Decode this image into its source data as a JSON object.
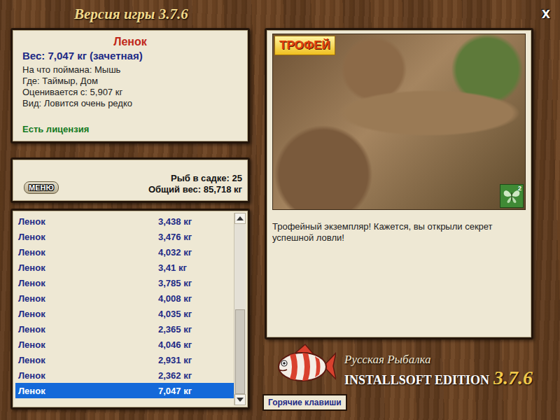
{
  "window": {
    "title": "Версия игры 3.7.6",
    "close": "X"
  },
  "fish_info": {
    "name": "Ленок",
    "weight": "Вес: 7,047 кг (зачетная)",
    "details": [
      "На что поймана: Мышь",
      "Где: Таймыр, Дом",
      "Оценивается с: 5,907 кг",
      "Вид: Ловится очень редко"
    ],
    "license": "Есть лицензия"
  },
  "keepnet": {
    "menu_button": "МЕНЮ",
    "count": "Рыб в садке: 25",
    "total": "Общий вес: 85,718 кг"
  },
  "catch_list": {
    "scroll": {
      "level": 1
    },
    "rows": [
      {
        "name": "Ленок",
        "weight": "3,438 кг",
        "selected": false
      },
      {
        "name": "Ленок",
        "weight": "3,476 кг",
        "selected": false
      },
      {
        "name": "Ленок",
        "weight": "4,032 кг",
        "selected": false
      },
      {
        "name": "Ленок",
        "weight": "3,41 кг",
        "selected": false
      },
      {
        "name": "Ленок",
        "weight": "3,785 кг",
        "selected": false
      },
      {
        "name": "Ленок",
        "weight": "4,008 кг",
        "selected": false
      },
      {
        "name": "Ленок",
        "weight": "4,035 кг",
        "selected": false
      },
      {
        "name": "Ленок",
        "weight": "2,365 кг",
        "selected": false
      },
      {
        "name": "Ленок",
        "weight": "4,046 кг",
        "selected": false
      },
      {
        "name": "Ленок",
        "weight": "2,931 кг",
        "selected": false
      },
      {
        "name": "Ленок",
        "weight": "2,362 кг",
        "selected": false
      },
      {
        "name": "Ленок",
        "weight": "7,047 кг",
        "selected": true
      }
    ]
  },
  "trophy": {
    "badge": "ТРОФЕЙ",
    "bait_count": "2",
    "message": "Трофейный экземпляр! Кажется, вы открыли секрет успешной ловли!"
  },
  "branding": {
    "subtitle": "Русская Рыбалка",
    "edition": "INSTALLSOFT EDITION",
    "version": "3.7.6"
  },
  "hotkeys_button": "Горячие клавиши"
}
